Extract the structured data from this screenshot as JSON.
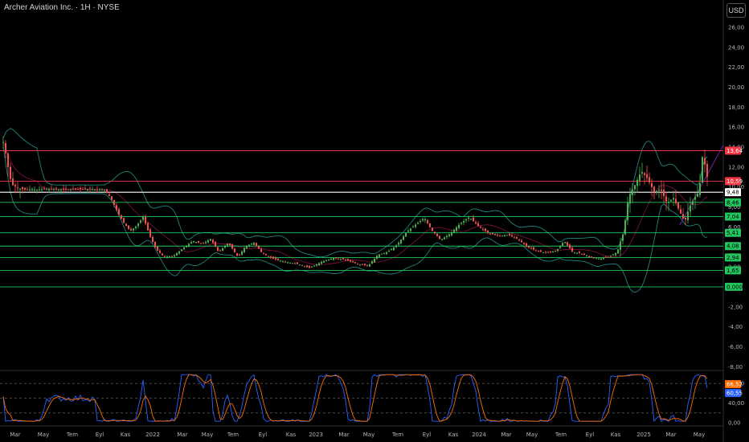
{
  "header": {
    "title": "Archer Aviation Inc. · 1H · NYSE",
    "currency_button": "USD"
  },
  "colors": {
    "background": "#000000",
    "up": "#26a69a",
    "up_candle": "#4caf50",
    "down": "#ef5350",
    "resistance": "#f23645",
    "level": "#22c55e",
    "white_level": "#ffffff",
    "bollinger": "#26a69a",
    "ma": "#c2185b",
    "trend": "#7b1fa2",
    "stoch_k": "#2962ff",
    "stoch_d": "#ff6d00"
  },
  "chart_data": {
    "type": "candlestick",
    "title": "Archer Aviation Inc. · 1H · NYSE",
    "y_axis": {
      "ticks": [
        "26,00",
        "24,00",
        "22,00",
        "20,00",
        "18,00",
        "16,00",
        "14,00",
        "12,00",
        "10,00",
        "8,00",
        "6,00",
        "4,00",
        "2,00",
        "0,00",
        "-2,00",
        "-4,00",
        "-6,00",
        "-8,00"
      ],
      "range": [
        -8.5,
        27
      ]
    },
    "x_axis": {
      "ticks": [
        "Mar",
        "May",
        "Tem",
        "Eyl",
        "Kas",
        "2022",
        "Mar",
        "May",
        "Tem",
        "Eyl",
        "Kas",
        "2023",
        "Mar",
        "May",
        "Tem",
        "Eyl",
        "Kas",
        "2024",
        "Mar",
        "May",
        "Tem",
        "Eyl",
        "Kas",
        "2025",
        "Mar",
        "May"
      ]
    },
    "price_path": [
      [
        0,
        11.5
      ],
      [
        4,
        14.5
      ],
      [
        8,
        13.0
      ],
      [
        12,
        11.0
      ],
      [
        16,
        10.2
      ],
      [
        22,
        9.9
      ],
      [
        30,
        9.75
      ],
      [
        45,
        9.75
      ],
      [
        60,
        9.8
      ],
      [
        80,
        9.75
      ],
      [
        100,
        9.8
      ],
      [
        120,
        9.75
      ],
      [
        130,
        9.7
      ],
      [
        138,
        8.9
      ],
      [
        146,
        7.5
      ],
      [
        154,
        6.4
      ],
      [
        162,
        5.6
      ],
      [
        170,
        6.1
      ],
      [
        178,
        7.0
      ],
      [
        186,
        5.2
      ],
      [
        194,
        3.8
      ],
      [
        204,
        3.0
      ],
      [
        216,
        3.1
      ],
      [
        228,
        3.9
      ],
      [
        240,
        4.6
      ],
      [
        252,
        4.3
      ],
      [
        262,
        4.8
      ],
      [
        272,
        3.5
      ],
      [
        284,
        4.4
      ],
      [
        296,
        3.0
      ],
      [
        306,
        4.1
      ],
      [
        316,
        4.4
      ],
      [
        326,
        3.4
      ],
      [
        340,
        2.8
      ],
      [
        355,
        2.5
      ],
      [
        370,
        2.3
      ],
      [
        385,
        1.9
      ],
      [
        400,
        2.5
      ],
      [
        415,
        2.9
      ],
      [
        430,
        2.7
      ],
      [
        445,
        2.3
      ],
      [
        458,
        2.1
      ],
      [
        470,
        3.2
      ],
      [
        482,
        3.5
      ],
      [
        494,
        4.2
      ],
      [
        506,
        5.5
      ],
      [
        518,
        6.3
      ],
      [
        528,
        6.9
      ],
      [
        538,
        5.6
      ],
      [
        548,
        4.7
      ],
      [
        560,
        5.3
      ],
      [
        572,
        6.3
      ],
      [
        584,
        7.0
      ],
      [
        596,
        6.0
      ],
      [
        608,
        5.4
      ],
      [
        620,
        5.1
      ],
      [
        632,
        5.2
      ],
      [
        644,
        4.8
      ],
      [
        656,
        4.0
      ],
      [
        668,
        3.6
      ],
      [
        680,
        3.4
      ],
      [
        692,
        3.6
      ],
      [
        702,
        4.6
      ],
      [
        712,
        3.5
      ],
      [
        724,
        3.3
      ],
      [
        734,
        3.0
      ],
      [
        746,
        2.8
      ],
      [
        758,
        3.0
      ],
      [
        768,
        3.5
      ],
      [
        776,
        5.5
      ],
      [
        782,
        9.0
      ],
      [
        790,
        10.2
      ],
      [
        798,
        11.6
      ],
      [
        806,
        10.8
      ],
      [
        814,
        9.5
      ],
      [
        822,
        9.8
      ],
      [
        830,
        8.4
      ],
      [
        838,
        8.9
      ],
      [
        846,
        7.5
      ],
      [
        852,
        6.5
      ],
      [
        858,
        8.0
      ],
      [
        864,
        8.9
      ],
      [
        870,
        9.5
      ],
      [
        874,
        13.0
      ],
      [
        878,
        12.0
      ],
      [
        881,
        10.5
      ]
    ],
    "price_labels": [
      {
        "value": 13.64,
        "text": "13,64",
        "color": "#f23645"
      },
      {
        "value": 10.59,
        "text": "10,59",
        "color": "#f23645"
      },
      {
        "value": 9.48,
        "text": "9,48",
        "color": "#ffffff"
      },
      {
        "value": 8.46,
        "text": "8,46",
        "color": "#22c55e"
      },
      {
        "value": 7.04,
        "text": "7,04",
        "color": "#22c55e"
      },
      {
        "value": 5.41,
        "text": "5,41",
        "color": "#22c55e"
      },
      {
        "value": 4.08,
        "text": "4,08",
        "color": "#22c55e"
      },
      {
        "value": 2.94,
        "text": "2,94",
        "color": "#22c55e"
      },
      {
        "value": 1.65,
        "text": "1,65",
        "color": "#22c55e"
      },
      {
        "value": 0.0,
        "text": "0,0000",
        "color": "#22c55e"
      }
    ],
    "horizontal_levels": [
      {
        "value": 13.64,
        "color": "#f23645"
      },
      {
        "value": 10.59,
        "color": "#f23645"
      },
      {
        "value": 9.48,
        "color": "#ffffff"
      },
      {
        "value": 8.46,
        "color": "#22c55e"
      },
      {
        "value": 7.04,
        "color": "#22c55e"
      },
      {
        "value": 5.41,
        "color": "#22c55e"
      },
      {
        "value": 4.08,
        "color": "#22c55e"
      },
      {
        "value": 2.94,
        "color": "#22c55e"
      },
      {
        "value": 1.65,
        "color": "#22c55e"
      },
      {
        "value": 0.0,
        "color": "#22c55e"
      }
    ],
    "stochastic": {
      "y_ticks": [
        "80,00",
        "40,00",
        "0,00"
      ],
      "range": [
        0,
        100
      ],
      "dashed_levels": [
        80,
        50,
        20
      ],
      "k_label": {
        "value": 66.52,
        "text": "66,52",
        "color": "#ff6d00"
      },
      "d_label": {
        "value": 60.55,
        "text": "60,55",
        "color": "#2962ff"
      }
    }
  }
}
